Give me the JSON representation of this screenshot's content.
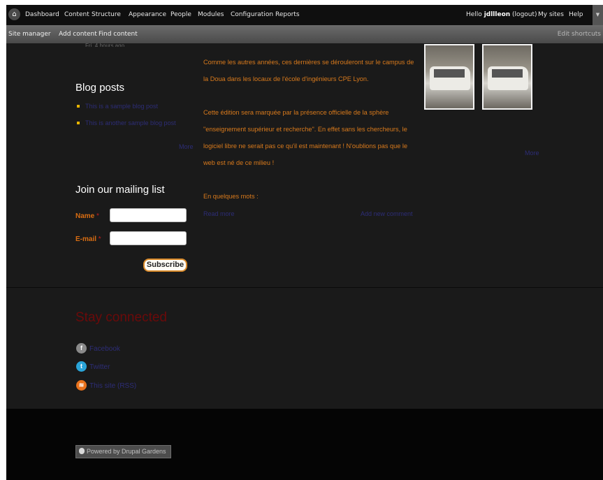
{
  "toolbar": {
    "home_icon": "home-icon",
    "items": [
      "Dashboard",
      "Content",
      "Structure",
      "Appearance",
      "People",
      "Modules",
      "Configuration",
      "Reports"
    ],
    "greeting": "Hello",
    "username": "jdllleon",
    "logout": "(logout)",
    "my_sites": "My sites",
    "help": "Help",
    "corner_icon": "chevron-down-icon"
  },
  "shortcuts": {
    "items": [
      "Site manager",
      "Add content",
      "Find content"
    ],
    "edit": "Edit shortcuts"
  },
  "sidebar": {
    "faint_date": "Fri, 4 hours ago",
    "blog_heading": "Blog posts",
    "blog_posts": [
      "This is a sample blog post",
      "This is another sample blog post"
    ],
    "blog_more": "More",
    "mailing_heading": "Join our mailing list",
    "name_label": "Name",
    "email_label": "E-mail",
    "required_marker": "*",
    "subscribe_label": "Subscribe"
  },
  "article": {
    "paragraph1": "Comme les autres années, ces dernières se dérouleront sur le campus de la Doua dans les locaux de l'école d'ingénieurs CPE Lyon.",
    "paragraph2": "Cette édition sera marquée par la présence officielle de la sphère \"enseignement supérieur et recherche\". En effet sans les chercheurs, le logiciel libre ne serait pas ce qu'il est maintenant ! N'oublions pas que le web est né de ce milieu !",
    "paragraph3": "En quelques mots :",
    "read_more": "Read more",
    "add_comment": "Add new comment",
    "gallery_more": "More"
  },
  "stay_connected": {
    "heading": "Stay connected",
    "links": [
      {
        "label": "Facebook",
        "icon": "facebook-icon",
        "color": "#8a8a8a",
        "glyph": "f"
      },
      {
        "label": "Twitter",
        "icon": "twitter-icon",
        "color": "#2aa4d8",
        "glyph": "t"
      },
      {
        "label": "This site (RSS)",
        "icon": "rss-icon",
        "color": "#e8721c",
        "glyph": "≋"
      }
    ]
  },
  "footer": {
    "powered_by": "Powered by Drupal Gardens"
  },
  "colors": {
    "accent_orange": "#d97a1c",
    "link_dark": "#2d2d77",
    "heading_red": "#6b0a0a",
    "bullet_yellow": "#e8b400"
  }
}
